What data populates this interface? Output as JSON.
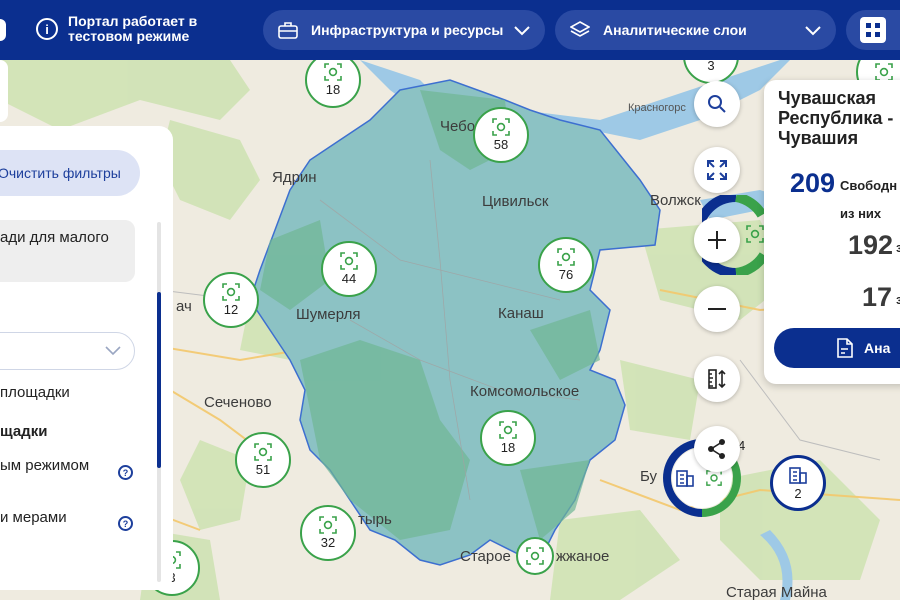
{
  "header": {
    "notice": "Портал работает в тестовом режиме",
    "menu_infrastructure": "Инфраструктура и ресурсы",
    "menu_analytics": "Аналитические слои"
  },
  "map": {
    "labels": {
      "cheboksary": "Чебо",
      "yadrin": "Ядрин",
      "tsivilsk": "Цивильск",
      "volzhsk": "Волжск",
      "shumerlya": "Шумерля",
      "kanash": "Канаш",
      "sechenovo": "Сеченово",
      "komsomolskoe": "Комсомольское",
      "alatyr": "тырь",
      "starye": "Старое",
      "drozhzhanoe": "жжаное",
      "krasnogorsk": "Красногорс",
      "buinsk": "Бу",
      "staraya_maina": "Старая Майна",
      "vach": "ач"
    },
    "clusters": [
      {
        "count": "18"
      },
      {
        "count": "58"
      },
      {
        "count": "3"
      },
      {
        "count": "44"
      },
      {
        "count": "76"
      },
      {
        "count": "12"
      },
      {
        "count": "51"
      },
      {
        "count": "18"
      },
      {
        "count": "32"
      },
      {
        "count": "3"
      },
      {
        "count": ""
      }
    ],
    "mixed_cluster_count": "4",
    "building_cluster_count": "2"
  },
  "filters": {
    "clear_label": "Очистить фильтры",
    "card_text": "ади для малого",
    "row_sites": "площадки",
    "row_sites_bold": "щадки",
    "row_regime": "ым режимом",
    "row_measures": "и мерами",
    "help_glyph": "?"
  },
  "info_card": {
    "title": "Чувашская Республика - Чувашия",
    "free_count": "209",
    "free_label": "Свободн",
    "of_them_label": "из них",
    "count_a": "192",
    "count_a_suffix": "з",
    "count_b": "17",
    "count_b_suffix": "з",
    "analytics_button": "Ана"
  },
  "colors": {
    "header_bg": "#0b2f8f",
    "region_fill": "#8cc2c4",
    "cluster_border": "#3aa24a",
    "accent_blue": "#1d3f9c"
  }
}
